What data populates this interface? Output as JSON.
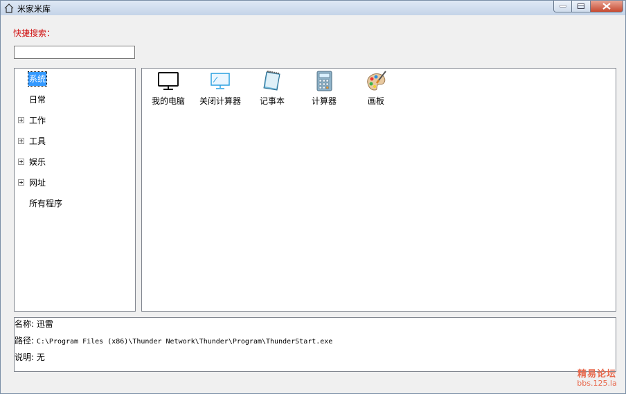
{
  "window": {
    "title": "米家米库"
  },
  "search": {
    "label": "快捷搜索：",
    "value": ""
  },
  "tree": {
    "items": [
      {
        "label": "系统",
        "expandable": false,
        "selected": true
      },
      {
        "label": "日常",
        "expandable": false,
        "selected": false
      },
      {
        "label": "工作",
        "expandable": true,
        "selected": false
      },
      {
        "label": "工具",
        "expandable": true,
        "selected": false
      },
      {
        "label": "娱乐",
        "expandable": true,
        "selected": false
      },
      {
        "label": "网址",
        "expandable": true,
        "selected": false
      },
      {
        "label": "所有程序",
        "expandable": false,
        "selected": false
      }
    ]
  },
  "icons": {
    "items": [
      {
        "label": "我的电脑",
        "icon": "monitor-icon"
      },
      {
        "label": "关闭计算器",
        "icon": "screen-off-icon"
      },
      {
        "label": "记事本",
        "icon": "notepad-icon"
      },
      {
        "label": "计算器",
        "icon": "calculator-icon"
      },
      {
        "label": "画板",
        "icon": "paint-palette-icon"
      }
    ]
  },
  "info": {
    "name_label": "名称:",
    "name_value": "迅雷",
    "path_label": "路径:",
    "path_value": "C:\\Program Files (x86)\\Thunder Network\\Thunder\\Program\\ThunderStart.exe",
    "desc_label": "说明:",
    "desc_value": "无"
  },
  "watermark": {
    "line1": "精易论坛",
    "line2": "bbs.125.la"
  },
  "colors": {
    "search_label": "#d01010",
    "selection": "#3399ff",
    "watermark": "#e8674a"
  }
}
